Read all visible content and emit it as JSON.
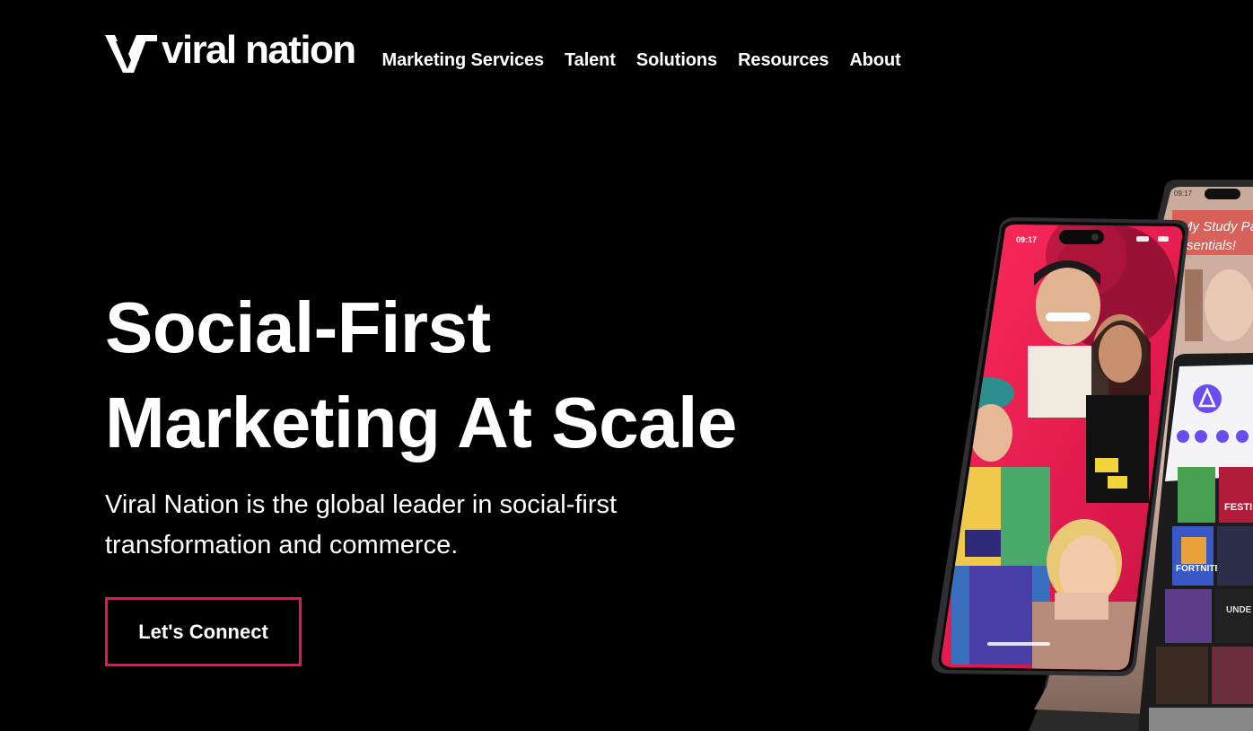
{
  "brand": {
    "logo_text": "viral nation",
    "accent_color": "#e8145c"
  },
  "nav": {
    "items": [
      {
        "label": "Marketing Services"
      },
      {
        "label": "Talent"
      },
      {
        "label": "Solutions"
      },
      {
        "label": "Resources"
      },
      {
        "label": "About"
      }
    ]
  },
  "hero": {
    "title_line1": "Social-First",
    "title_line2": "Marketing At Scale",
    "subtitle_line1": "Viral Nation is the global leader in social-first",
    "subtitle_line2": "transformation and commerce.",
    "cta_label": "Let's Connect"
  },
  "phones": {
    "front_time": "09:17",
    "back_time": "09:17",
    "back_screen_text_line1": "My Study Pa",
    "back_screen_text_line2": "sentials!",
    "game_tile_label": "FORTNITE",
    "side_label": "FESTI",
    "side_label2": "UNDE"
  }
}
